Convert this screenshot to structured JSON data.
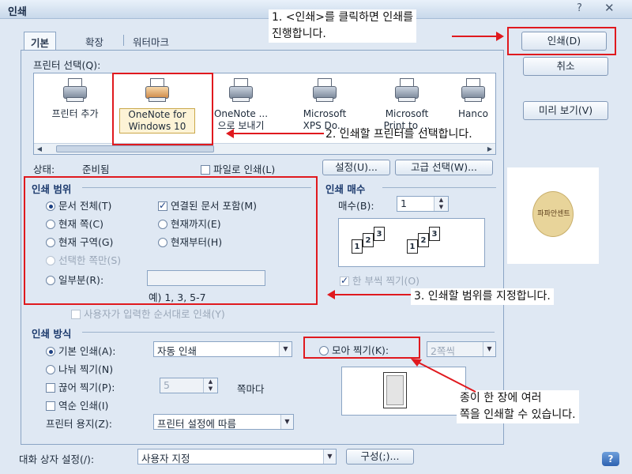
{
  "window": {
    "title": "인쇄",
    "help": "?",
    "close": "✕"
  },
  "tabs": [
    {
      "label": "기본",
      "active": true
    },
    {
      "label": "확장",
      "active": false
    },
    {
      "label": "워터마크",
      "active": false
    }
  ],
  "printer_select": {
    "label": "프린터 선택(Q):",
    "printers": [
      {
        "name": "프린터 추가",
        "icon": "add-printer-icon"
      },
      {
        "name": "OneNote for Windows 10",
        "icon": "onenote-printer-icon",
        "selected": true
      },
      {
        "name": "OneNote ...\n으로 보내기",
        "icon": "printer-icon"
      },
      {
        "name": "Microsoft\nXPS Do...",
        "icon": "printer-icon"
      },
      {
        "name": "Microsoft\nPrint to ...",
        "icon": "printer-icon"
      },
      {
        "name": "Hanco",
        "icon": "printer-icon"
      }
    ]
  },
  "status": {
    "label": "상태:",
    "value": "준비됨",
    "print_to_file": "파일로 인쇄(L)",
    "settings": "설정(U)...",
    "advanced": "고급 선택(W)..."
  },
  "right_buttons": {
    "print": "인쇄(D)",
    "cancel": "취소",
    "preview": "미리 보기(V)"
  },
  "print_range": {
    "title": "인쇄 범위",
    "all": "문서 전체(T)",
    "include_linked": "연결된 문서 포함(M)",
    "current_page": "현재 쪽(C)",
    "up_to_current": "현재까지(E)",
    "current_section": "현재 구역(G)",
    "from_current": "현재부터(H)",
    "selection": "선택한 쪽만(S)",
    "some": "일부분(R):",
    "example": "예) 1, 3, 5-7",
    "user_order": "사용자가 입력한 순서대로 인쇄(Y)"
  },
  "copies": {
    "title": "인쇄 매수",
    "label": "매수(B):",
    "value": "1",
    "collate": "한 부씩 찍기(O)"
  },
  "print_method": {
    "title": "인쇄 방식",
    "basic": "기본 인쇄(A):",
    "basic_value": "자동 인쇄",
    "split": "나눠 찍기(N)",
    "cut": "끊어 찍기(P):",
    "cut_value": "5",
    "per_page": "쪽마다",
    "reverse": "역순 인쇄(I)",
    "paper_label": "프린터 용지(Z):",
    "paper_value": "프린터 설정에 따름",
    "nup": "모아 찍기(K):",
    "nup_value": "2쪽씩"
  },
  "footer": {
    "label": "대화 상자 설정(/):",
    "value": "사용자 지정",
    "config": "구성(;)..."
  },
  "stamp": {
    "text": "파파안센트"
  },
  "annotations": {
    "a1_line1": "1. <인쇄>를 클릭하면 인쇄를",
    "a1_line2": "진행합니다.",
    "a2": "2. 인쇄할 프린터를 선택합니다.",
    "a3": "3. 인쇄할 범위를 지정합니다.",
    "a4_line1": "종이 한 장에 여러",
    "a4_line2": "쪽을 인쇄할 수 있습니다."
  },
  "colors": {
    "highlight": "#e0191e",
    "dialog_bg": "#dfe8f3",
    "accent": "#1d3b6e"
  }
}
